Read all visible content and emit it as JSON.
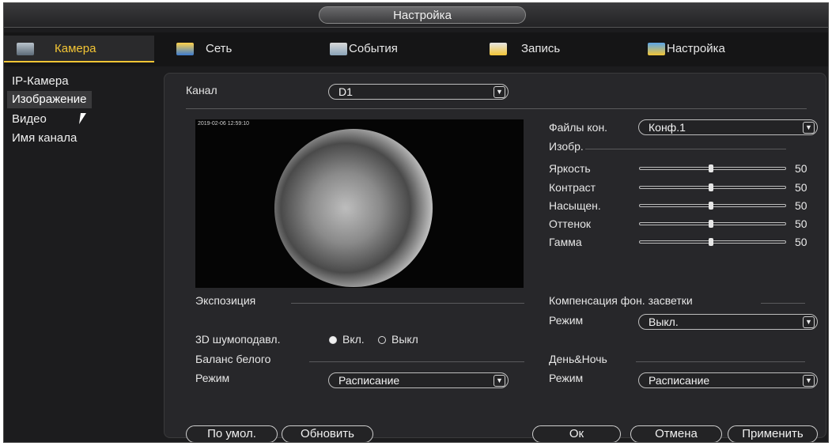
{
  "window": {
    "title": "Настройка"
  },
  "tabs": [
    {
      "label": "Камера",
      "icon": "camera-icon",
      "active": true
    },
    {
      "label": "Сеть",
      "icon": "network-icon",
      "active": false
    },
    {
      "label": "События",
      "icon": "events-icon",
      "active": false
    },
    {
      "label": "Запись",
      "icon": "record-icon",
      "active": false
    },
    {
      "label": "Настройка",
      "icon": "settings-icon",
      "active": false
    }
  ],
  "sidebar": {
    "items": [
      {
        "label": "IP-Камера"
      },
      {
        "label": "Изображение",
        "active": true
      },
      {
        "label": "Видео"
      },
      {
        "label": "Имя канала"
      }
    ]
  },
  "channel": {
    "label": "Канал",
    "value": "D1"
  },
  "preview": {
    "timestamp": "2019-02-06 12:59:10"
  },
  "config": {
    "label": "Файлы кон.",
    "value": "Конф.1"
  },
  "image": {
    "section": "Изобр.",
    "sliders": [
      {
        "label": "Яркость",
        "value": 50
      },
      {
        "label": "Контраст",
        "value": 50
      },
      {
        "label": "Насыщен.",
        "value": 50
      },
      {
        "label": "Оттенок",
        "value": 50
      },
      {
        "label": "Гамма",
        "value": 50
      }
    ]
  },
  "exposure": {
    "section": "Экспозиция"
  },
  "backlight": {
    "section": "Компенсация фон. засветки",
    "mode_label": "Режим",
    "mode_value": "Выкл."
  },
  "denoise": {
    "label": "3D шумоподавл.",
    "on_label": "Вкл.",
    "off_label": "Выкл",
    "selected": "on"
  },
  "white_balance": {
    "section": "Баланс белого",
    "mode_label": "Режим",
    "mode_value": "Расписание"
  },
  "day_night": {
    "section": "День&Ночь",
    "mode_label": "Режим",
    "mode_value": "Расписание"
  },
  "buttons": {
    "default": "По умол.",
    "refresh": "Обновить",
    "ok": "Ок",
    "cancel": "Отмена",
    "apply": "Применить"
  },
  "colors": {
    "accent": "#f3c535",
    "background": "#1c1c1e"
  }
}
